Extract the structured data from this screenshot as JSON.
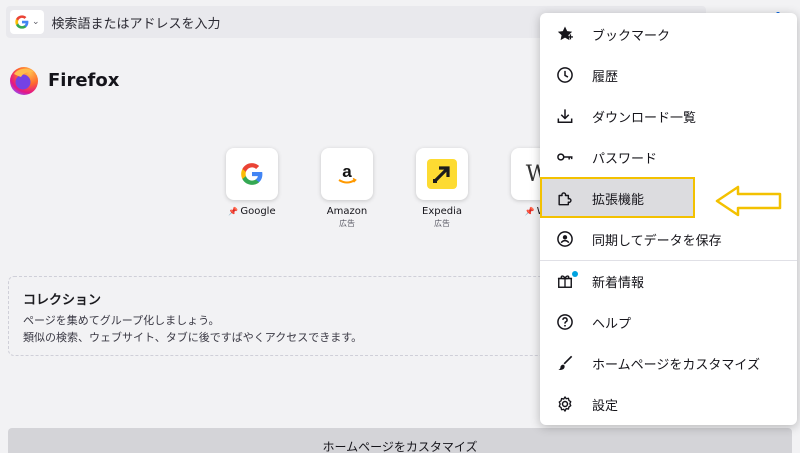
{
  "urlbar": {
    "placeholder": "検索語またはアドレスを入力",
    "engine_icon": "google-icon"
  },
  "brand": {
    "name": "Firefox"
  },
  "top_sites": [
    {
      "label": "Google",
      "sub": "",
      "pinned": true,
      "icon": "google-icon"
    },
    {
      "label": "Amazon",
      "sub": "広告",
      "pinned": false,
      "icon": "amazon-icon"
    },
    {
      "label": "Expedia",
      "sub": "広告",
      "pinned": false,
      "icon": "expedia-icon"
    },
    {
      "label": "Wi",
      "sub": "",
      "pinned": true,
      "icon": "wikipedia-icon"
    }
  ],
  "collections": {
    "title": "コレクション",
    "line1": "ページを集めてグループ化しましょう。",
    "line2": "類似の検索、ウェブサイト、タブに後ですばやくアクセスできます。"
  },
  "bottom_bar": {
    "label": "ホームページをカスタマイズ"
  },
  "menu": {
    "items": [
      {
        "label": "ブックマーク",
        "icon": "star-icon"
      },
      {
        "label": "履歴",
        "icon": "clock-icon"
      },
      {
        "label": "ダウンロード一覧",
        "icon": "download-icon"
      },
      {
        "label": "パスワード",
        "icon": "key-icon"
      },
      {
        "label": "拡張機能",
        "icon": "puzzle-icon",
        "highlighted": true
      },
      {
        "label": "同期してデータを保存",
        "icon": "account-icon"
      },
      {
        "label": "新着情報",
        "icon": "gift-icon"
      },
      {
        "label": "ヘルプ",
        "icon": "help-icon"
      },
      {
        "label": "ホームページをカスタマイズ",
        "icon": "brush-icon"
      },
      {
        "label": "設定",
        "icon": "gear-icon"
      }
    ]
  },
  "colors": {
    "highlight_border": "#f3c100",
    "arrow": "#f3c100",
    "accent_dot": "#00a3e0"
  }
}
